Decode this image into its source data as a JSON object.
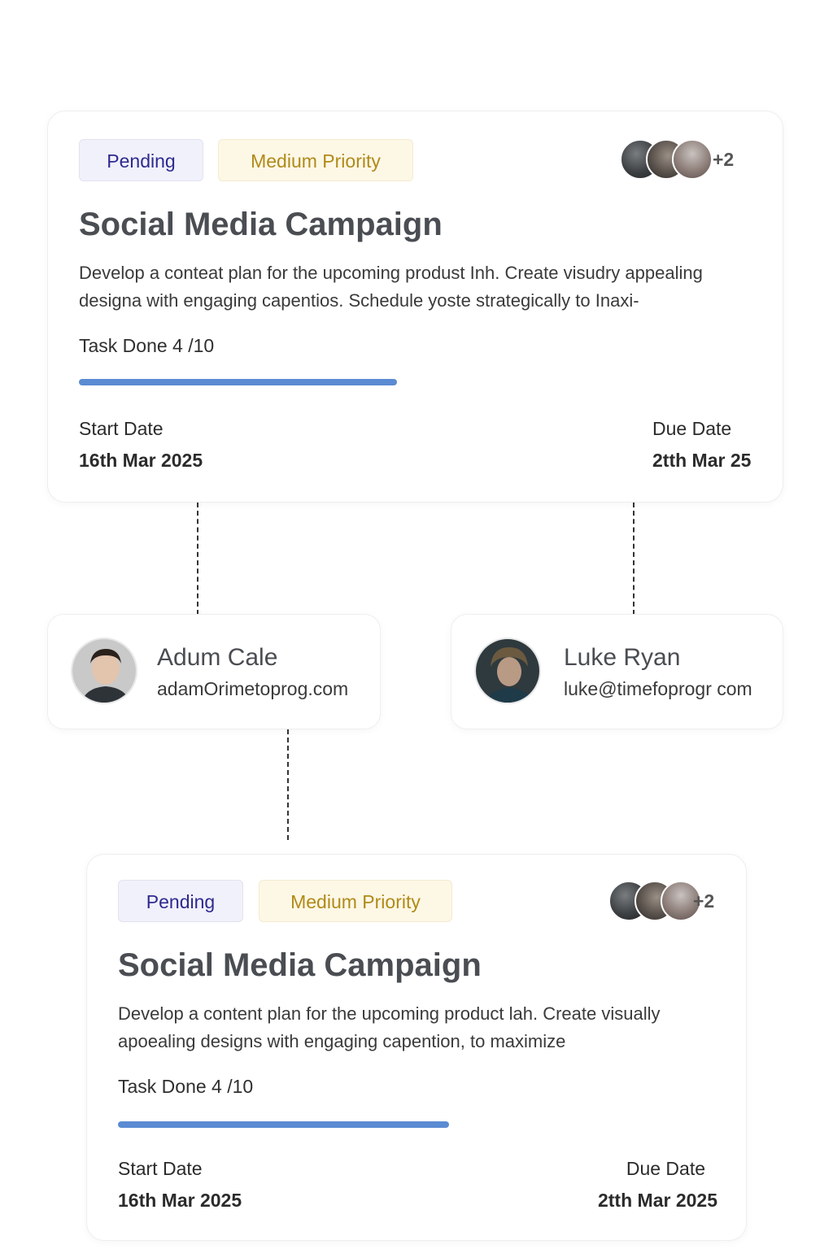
{
  "colors": {
    "pending_bg": "#f1f1fb",
    "pending_text": "#2e2a8f",
    "priority_bg": "#fdf7e6",
    "priority_text": "#b08b18",
    "progress": "#5b8bd2",
    "title": "#4a4d52"
  },
  "cards": [
    {
      "status": "Pending",
      "priority": "Medium Priority",
      "assignee_extra": "+2",
      "title": "Social Media Campaign",
      "description": "Develop a conteat plan for the upcoming produst Inh. Create visudry appealing designa with engaging capentios. Schedule yoste strategically to Inaxi-",
      "task_done": "Task Done 4 /10",
      "progress_fraction": 0.4,
      "start_label": "Start Date",
      "start_value": "16th Mar 2025",
      "due_label": "Due Date",
      "due_value": "2tth Mar 25"
    },
    {
      "status": "Pending",
      "priority": "Medium Priority",
      "assignee_extra": "+2",
      "title": "Social Media Campaign",
      "description": "Develop a content plan for the upcoming product lah. Create visually apoealing designs with engaging capention, to maximize",
      "task_done": "Task Done 4 /10",
      "progress_fraction": 0.4,
      "start_label": "Start Date",
      "start_value": "16th Mar 2025",
      "due_label": "Due Date",
      "due_value": "2tth Mar 2025"
    }
  ],
  "people": [
    {
      "name": "Adum Cale",
      "email": "adamOrimetoprog.com",
      "icon": "avatar-photo"
    },
    {
      "name": "Luke Ryan",
      "email": "luke@timefoprogr com",
      "icon": "avatar-photo"
    }
  ]
}
